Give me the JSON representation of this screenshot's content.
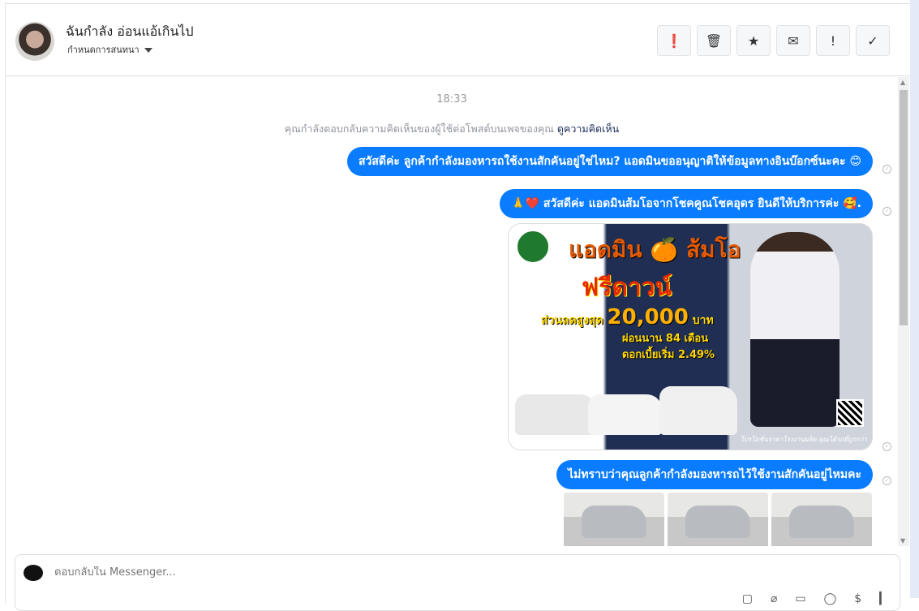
{
  "header": {
    "name": "ฉันกำลัง อ่อนแอ้เกินไป",
    "subtitle": "กำหนดการสนทนา",
    "buttons": [
      {
        "icon": "alert-circle-icon",
        "glyph": "❗"
      },
      {
        "icon": "trash-icon",
        "glyph": "🗑"
      },
      {
        "icon": "star-icon",
        "glyph": "★"
      },
      {
        "icon": "envelope-icon",
        "glyph": "✉"
      },
      {
        "icon": "exclamation-icon",
        "glyph": "!"
      },
      {
        "icon": "check-icon",
        "glyph": "✓"
      }
    ]
  },
  "thread": {
    "time": "18:33",
    "notice": "คุณกำลังตอบกลับความคิดเห็นของผู้ใช้ต่อโพสต์บนเพจของคุณ",
    "notice_link": "ดูความคิดเห็น",
    "messages": [
      "สวัสดีค่ะ ลูกค้ากำลังมองหารถใช้งานสักคันอยู่ใช่ไหม? แอดมินขออนุญาติให้ข้อมูลทางอินบ๊อกซ์นะคะ 😊",
      "🙏❤️ สวัสดีค่ะ แอดมินส้มโอจากโชคคูณโชคอุดร ยินดีให้บริการค่ะ 🥰.",
      "ไม่ทราบว่าคุณลูกค้ากำลังมองหารถไว้ใช้งานสักคันอยู่ไหมคะ"
    ],
    "promo": {
      "title": "แอดมิน 🍊 ส้มโอ",
      "headline": "ฟรีดาวน์",
      "discount_label": "ส่วนลดสูงสุด",
      "discount_amount": "20,000",
      "discount_unit": "บาท",
      "installment": "ผ่อนนาน 84 เดือน",
      "interest": "ดอกเบี้ยเริ่ม 2.49%",
      "footer": "โปรโมชั่นราคาโรงงานผลิต คุณได้รถที่ถูกกว่า"
    }
  },
  "composer": {
    "placeholder": "ตอบกลับใน Messenger..."
  }
}
